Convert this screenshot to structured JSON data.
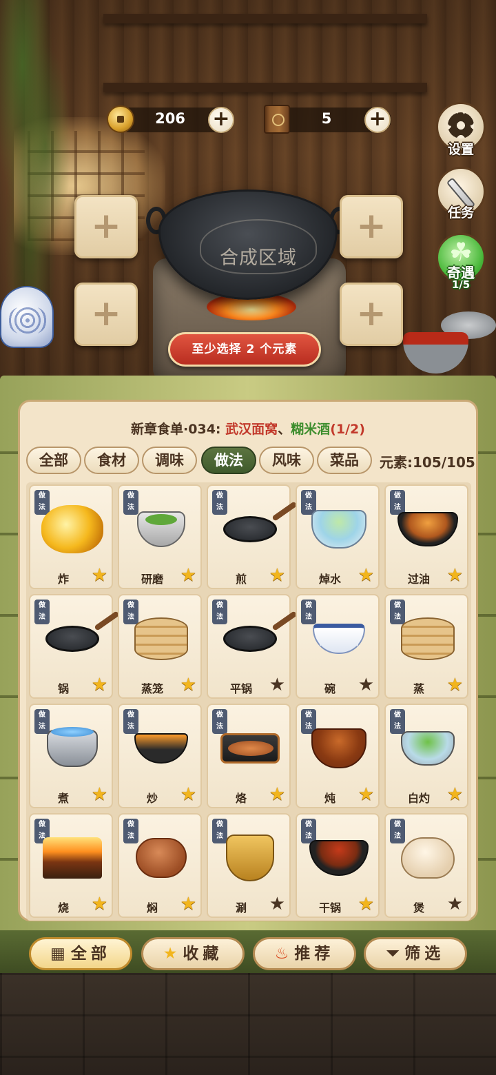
{
  "resources": {
    "coins": {
      "icon": "coin-icon",
      "value": "206",
      "add_label": "+"
    },
    "books": {
      "icon": "book-icon",
      "value": "5",
      "add_label": "+"
    }
  },
  "side_buttons": {
    "settings": {
      "icon": "gear-icon",
      "label": "设置"
    },
    "tasks": {
      "icon": "task-icon",
      "label": "任务"
    },
    "encounter": {
      "icon": "clover-icon",
      "label": "奇遇",
      "progress": "1/5"
    }
  },
  "synthesis": {
    "area_label": "合成区域",
    "slot_label": "+",
    "hint": "至少选择 2 个元素"
  },
  "recipe": {
    "prefix": "新章食单·034: ",
    "dish1": "武汉面窝",
    "sep": "、",
    "dish2": "糊米酒",
    "progress": "(1/2)"
  },
  "tabs": [
    {
      "label": "全部",
      "active": false
    },
    {
      "label": "食材",
      "active": false
    },
    {
      "label": "调味",
      "active": false
    },
    {
      "label": "做法",
      "active": true
    },
    {
      "label": "风味",
      "active": false
    },
    {
      "label": "菜品",
      "active": false
    }
  ],
  "element_count": "元素:105/105",
  "tag_label": "做\n法",
  "items": [
    {
      "label": "炸",
      "icon": "fried-icon",
      "star": "gold"
    },
    {
      "label": "研磨",
      "icon": "mortar-icon",
      "star": "gold"
    },
    {
      "label": "煎",
      "icon": "pan-fry-icon",
      "star": "gold"
    },
    {
      "label": "焯水",
      "icon": "blanch-icon",
      "star": "gold"
    },
    {
      "label": "过油",
      "icon": "oil-fry-icon",
      "star": "gold"
    },
    {
      "label": "锅",
      "icon": "wok-icon",
      "star": "gold"
    },
    {
      "label": "蒸笼",
      "icon": "steamer-icon",
      "star": "gold"
    },
    {
      "label": "平锅",
      "icon": "flat-pan-icon",
      "star": "dark"
    },
    {
      "label": "碗",
      "icon": "bowl-icon",
      "star": "dark"
    },
    {
      "label": "蒸",
      "icon": "steam-icon",
      "star": "gold"
    },
    {
      "label": "煮",
      "icon": "boil-icon",
      "star": "gold"
    },
    {
      "label": "炒",
      "icon": "stir-fry-icon",
      "star": "gold"
    },
    {
      "label": "烙",
      "icon": "griddle-icon",
      "star": "gold"
    },
    {
      "label": "炖",
      "icon": "stew-icon",
      "star": "gold"
    },
    {
      "label": "白灼",
      "icon": "poach-icon",
      "star": "gold"
    },
    {
      "label": "烧",
      "icon": "grill-icon",
      "star": "gold"
    },
    {
      "label": "焖",
      "icon": "clay-pot-icon",
      "star": "gold"
    },
    {
      "label": "涮",
      "icon": "hot-pot-icon",
      "star": "dark"
    },
    {
      "label": "干锅",
      "icon": "dry-pot-icon",
      "star": "gold"
    },
    {
      "label": "煲",
      "icon": "casserole-icon",
      "star": "dark"
    }
  ],
  "bottom_nav": [
    {
      "label": "全部",
      "icon": "grid-icon",
      "active": true
    },
    {
      "label": "收藏",
      "icon": "star-icon",
      "active": false
    },
    {
      "label": "推荐",
      "icon": "fire-icon",
      "active": false
    },
    {
      "label": "筛选",
      "icon": "filter-icon",
      "active": false
    }
  ],
  "colors": {
    "accent_red": "#c2392b",
    "accent_green": "#3e8e2e",
    "star_gold": "#f2b51d",
    "active_tab": "#3f5a2c",
    "hint_button": "#b82d20"
  }
}
